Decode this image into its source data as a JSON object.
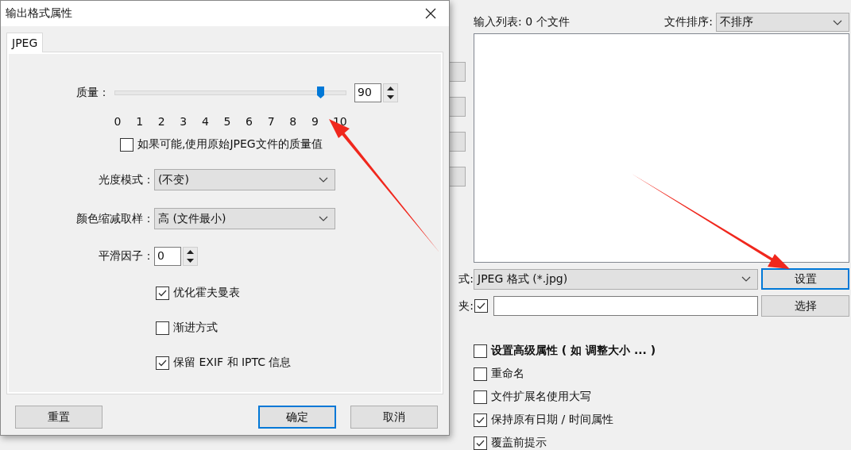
{
  "dialog": {
    "title": "输出格式属性",
    "tabs": [
      {
        "label": "JPEG",
        "selected": true
      }
    ],
    "quality": {
      "label": "质量：",
      "level": 0.9,
      "value": "90",
      "ticks": [
        "0",
        "1",
        "2",
        "3",
        "4",
        "5",
        "6",
        "7",
        "8",
        "9",
        "10"
      ]
    },
    "use_original_quality": {
      "label": "如果可能,使用原始JPEG文件的质量值",
      "checked": false
    },
    "fields": [
      {
        "kind": "select",
        "label": "光度模式：",
        "value": "(不变)"
      },
      {
        "kind": "select",
        "label": "颜色缩减取样：",
        "value": "高 (文件最小)"
      },
      {
        "kind": "spin",
        "label": "平滑因子：",
        "value": "0"
      }
    ],
    "options": [
      {
        "label": "优化霍夫曼表",
        "checked": true
      },
      {
        "label": "渐进方式",
        "checked": false
      },
      {
        "label": "保留 EXIF 和 IPTC 信息",
        "checked": true
      }
    ],
    "buttons": [
      {
        "label": "重置",
        "default": false
      },
      {
        "label": "确定",
        "default": true
      },
      {
        "label": "取消",
        "default": false
      }
    ]
  },
  "main": {
    "input_list_label": "输入列表: 0 个文件",
    "sort": {
      "label": "文件排序:",
      "value": "不排序"
    },
    "format": {
      "label": "式:",
      "value": "JPEG 格式 (*.jpg)",
      "button": "设置",
      "focused": true
    },
    "folder": {
      "label": "夹:",
      "checked": true,
      "button": "选择"
    },
    "options": [
      {
        "label": "设置高级属性 ( 如 调整大小 ... )",
        "checked": false,
        "bold": true
      },
      {
        "label": "重命名",
        "checked": false,
        "bold": false
      },
      {
        "label": "文件扩展名使用大写",
        "checked": false,
        "bold": false
      },
      {
        "label": "保持原有日期 / 时间属性",
        "checked": true,
        "bold": false
      },
      {
        "label": "覆盖前提示",
        "checked": true,
        "bold": false
      }
    ]
  }
}
